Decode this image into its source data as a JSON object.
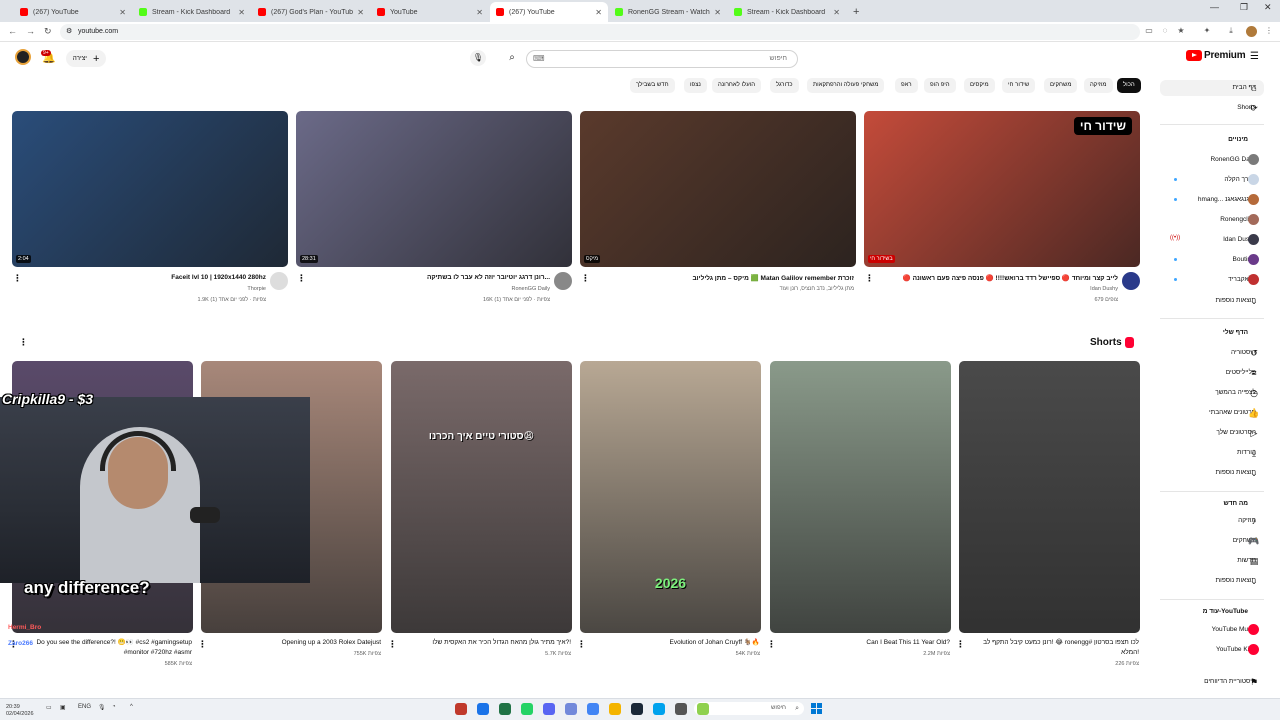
{
  "browser": {
    "tabs": [
      {
        "label": "(267) YouTube",
        "color": "#ff0000",
        "active": false
      },
      {
        "label": "Stream - Kick Dashboard",
        "color": "#53fc18",
        "active": false
      },
      {
        "label": "(267) God's Plan - YouTube",
        "color": "#ff0000",
        "active": false
      },
      {
        "label": "YouTube",
        "color": "#ff0000",
        "active": false
      },
      {
        "label": "(267) YouTube",
        "color": "#ff0000",
        "active": true
      },
      {
        "label": "RonenGG Stream - Watch Live",
        "color": "#53fc18",
        "active": false
      },
      {
        "label": "Stream - Kick Dashboard",
        "color": "#53fc18",
        "active": false
      }
    ],
    "new_tab": "+",
    "url": "youtube.com"
  },
  "masthead": {
    "search_placeholder": "חיפוש",
    "create_label": "יצירה",
    "notifications_count": "9+",
    "logo_text": "Premium"
  },
  "chips": [
    "הכול",
    "מוזיקה",
    "משחקים",
    "שידור חי",
    "מיקסים",
    "היפ הופ",
    "ראפ",
    "משחקי פעולה והרפתקאות",
    "כדורגל",
    "הועלו לאחרונה",
    "נצפו",
    "חדש בשבילך"
  ],
  "sidebar": {
    "home": "דף הבית",
    "shorts": "Shorts",
    "subs_header": "מינויים",
    "subscriptions": [
      {
        "name": "RonenGG Daily",
        "color": "#7a7a7a",
        "dot": false,
        "live": false
      },
      {
        "name": "הדרך הקלה",
        "color": "#c9d6e6",
        "dot": true,
        "live": false
      },
      {
        "name": "hmang... גאגנגאגאגנ",
        "color": "#b56a3a",
        "dot": true,
        "live": false
      },
      {
        "name": "Ronengclips",
        "color": "#a36a5a",
        "dot": false,
        "live": false
      },
      {
        "name": "Idan Dushy",
        "color": "#3a3a4a",
        "dot": false,
        "live": true
      },
      {
        "name": "Boutinio",
        "color": "#6a3a8a",
        "dot": true,
        "live": false
      },
      {
        "name": "פלאקבריד",
        "color": "#c03030",
        "dot": true,
        "live": false
      }
    ],
    "more1": "תוצאות נוספות",
    "you_header": "הדף שלי",
    "you_items": [
      "היסטוריה",
      "פלייליסטים",
      "לצפייה בהמשך",
      "סרטונים שאהבתי",
      "הסרטונים שלך",
      "הורדות",
      "תוצאות נוספות"
    ],
    "explore_header": "מה חדש",
    "explore_items": [
      "מוזיקה",
      "משחקים",
      "חדשות",
      "תוצאות נוספות"
    ],
    "more_yt_header": "עוד מ-YouTube",
    "more_yt_items": [
      "YouTube Music",
      "YouTube Kids"
    ],
    "last_item": "היסטוריית הדיווחים"
  },
  "videos": [
    {
      "title": "Faceit lvl 10 | 1920x1440 280hz",
      "channel": "Thorpie",
      "meta": "1.9K צפיות · לפני יום אחד (1)",
      "duration": "2:04",
      "thumb": "#2a4d7a",
      "avatar": "#dddddd"
    },
    {
      "title": "רונן דרגג יוטיובר יוזה לא עבר לו בשתיקה...",
      "channel": "RonenGG Daily",
      "meta": "16K צפיות · לפני יום אחד (1)",
      "duration": "28:31",
      "thumb": "#6b6a88",
      "avatar": "#888888"
    },
    {
      "title": "מיקס – מתן גליליוב 🟩 Matan Galilov remember זוכרת",
      "channel": "מתן גליליוב, נדב חנציס, רונן ועוד",
      "meta": "",
      "duration": "מיקס",
      "thumb": "#5a3a2c",
      "avatar": ""
    },
    {
      "title": "🔴 לייב קצר ומיוחד 🔴 ספיישל רדד ברואש!!!! 🔴 פנסה פיצה פעם ראשונה",
      "channel": "Idan Dushy",
      "meta": "679 צופים",
      "duration": "בשידור חי",
      "thumb": "#c44b3a",
      "avatar": "#2a3a8a",
      "live_badge": "שידור חי"
    }
  ],
  "shorts_header": "Shorts",
  "shorts": [
    {
      "title": "Do you see the difference?! 😬👀 #cs2 #gamingsetup #monitor #720hz #asmr",
      "meta": "585K צפיות",
      "thumb": "#5a4a6a"
    },
    {
      "title": "Opening up a 2003 Rolex Datejust",
      "meta": "755K צפיות",
      "thumb": "#a8887a"
    },
    {
      "title": "איך מתיר גולן מהאח הגדול הכיר את האקסית שלו?!",
      "meta": "5.7K צפיות",
      "thumb": "#7a6a6a",
      "overlay": "סטורי טיים איך הכרנו😩"
    },
    {
      "title": "Evolution of Johan Cruyff 🐐🔥",
      "meta": "54K צפיות",
      "thumb": "#b8a894",
      "overlay": "2026"
    },
    {
      "title": "Can I Beat This 11 Year Old?",
      "meta": "2.2M צפיות",
      "thumb": "#8a9a8a"
    },
    {
      "title": "רונן כמעט קיבל התקף לב! 😂 ronengg# לכו תצפו בסרטון המלא!",
      "meta": "226 צפיות",
      "thumb": "#4a4a4a"
    }
  ],
  "overlay": {
    "streamer_name": "Cripkilla9 - $3",
    "caption": "any difference?",
    "chat": [
      {
        "user": "Hermi_Bro",
        "color": "#ff5a5a"
      },
      {
        "user": "Zaro266",
        "color": "#4a7aff"
      }
    ]
  },
  "taskbar": {
    "time": "20:39",
    "date": "02/04/2026",
    "lang": "ENG",
    "search_placeholder": "חיפוש"
  }
}
